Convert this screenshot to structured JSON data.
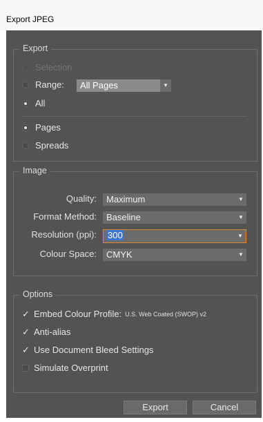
{
  "window": {
    "title": "Export JPEG"
  },
  "export_group": {
    "label": "Export",
    "selection_label": "Selection",
    "range_label": "Range:",
    "range_value": "All Pages",
    "all_label": "All",
    "pages_label": "Pages",
    "spreads_label": "Spreads",
    "selected_scope": "All",
    "selected_layout": "Pages"
  },
  "image_group": {
    "label": "Image",
    "quality_label": "Quality:",
    "quality_value": "Maximum",
    "format_label": "Format Method:",
    "format_value": "Baseline",
    "resolution_label": "Resolution (ppi):",
    "resolution_value": "300",
    "colour_label": "Colour Space:",
    "colour_value": "CMYK"
  },
  "options_group": {
    "label": "Options",
    "embed_label": "Embed Colour Profile:",
    "embed_profile": "U.S. Web Coated (SWOP) v2",
    "embed_checked": true,
    "antialias_label": "Anti-alias",
    "antialias_checked": true,
    "bleed_label": "Use Document Bleed Settings",
    "bleed_checked": true,
    "overprint_label": "Simulate Overprint",
    "overprint_checked": false
  },
  "buttons": {
    "export_label": "Export",
    "cancel_label": "Cancel"
  }
}
